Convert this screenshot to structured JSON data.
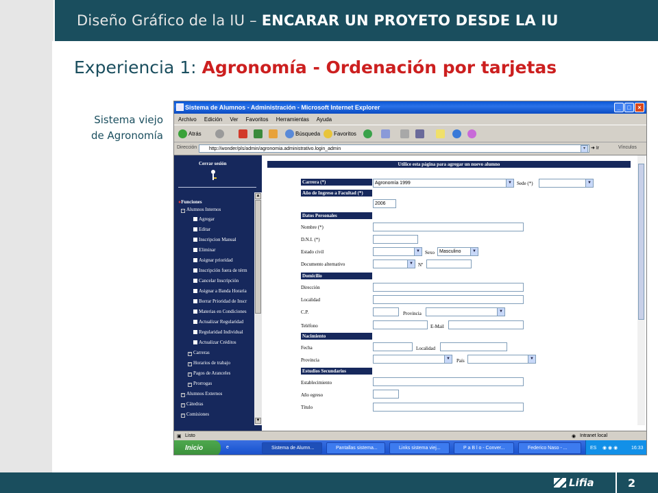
{
  "slide": {
    "title_prefix": "Diseño Gráfico de la IU –",
    "title_bold": "ENCARAR UN PROYETO DESDE LA IU",
    "heading_prefix": "Experiencia 1:",
    "heading_highlight": "Agronomía - Ordenación por tarjetas",
    "caption_line1": "Sistema viejo",
    "caption_line2": "de Agronomía",
    "logo_text": "Lifia",
    "page_number": "2",
    "colors": {
      "brand": "#1a4e5e",
      "highlight": "#cc1f1f",
      "panel": "#e6e6e6"
    }
  },
  "browser": {
    "window_title": "Sistema de Alumnos - Administración - Microsoft Internet Explorer",
    "menu": [
      "Archivo",
      "Edición",
      "Ver",
      "Favoritos",
      "Herramientas",
      "Ayuda"
    ],
    "toolbar": {
      "back": "Atrás",
      "search": "Búsqueda",
      "favorites": "Favoritos"
    },
    "address_label": "Dirección",
    "address_value": "http://wonder/pls/admin/agronomia.administrativo.login_admin",
    "go_label": "Ir",
    "links_label": "Vínculos",
    "status_text": "Listo",
    "zone_text": "Intranet local"
  },
  "sidebar": {
    "logout": "Cerrar sesión",
    "functions": "Funciones",
    "group": "Alumnos Internos",
    "items": [
      "Agregar",
      "Editar",
      "Inscripcion Manual",
      "Eliminar",
      "Asignar prioridad",
      "Inscripción fuera de térm",
      "Cancelar Inscripción",
      "Asignar a Banda Horaria",
      "Borrar Prioridad de Inscr",
      "Materias en Condiciones",
      "Actualizar Regularidad",
      "Regularidad Individual",
      "Actualizar Créditos"
    ],
    "subgroups": [
      "Carreras",
      "Horarios de trabajo",
      "Pagos de Aranceles",
      "Prorrogas"
    ],
    "groups": [
      "Alumnos Externos",
      "Cátedras",
      "Comisiones"
    ]
  },
  "form": {
    "header": "Utilice esta página para agregar un nuevo alumno",
    "carrera_label": "Carrera (*)",
    "carrera_value": "Agronomía 1999",
    "sede_label": "Sede (*)",
    "anio_label": "Año de Ingreso a Facultad (*)",
    "anio_value": "2006",
    "sec_personales": "Datos Personales",
    "nombre_label": "Nombre (*)",
    "dni_label": "D.N.I. (*)",
    "estado_label": "Estado civil",
    "sexo_label": "Sexo",
    "sexo_value": "Masculino",
    "doc_alt_label": "Documento alternativo",
    "nro_label": "Nº",
    "sec_domicilio": "Domicilio",
    "direccion_label": "Dirección",
    "localidad_label": "Localidad",
    "cp_label": "C.P.",
    "provincia_label": "Provincia",
    "telefono_label": "Teléfono",
    "email_label": "E-Mail",
    "sec_nacimiento": "Nacimiento",
    "fecha_label": "Fecha",
    "nac_localidad_label": "Localidad",
    "nac_provincia_label": "Provincia",
    "pais_label": "País",
    "sec_estudios": "Estudios Secundarios",
    "establecimiento_label": "Establecimiento",
    "anio_egreso_label": "Año egreso",
    "titulo_label": "Título"
  },
  "taskbar": {
    "start": "Inicio",
    "tasks": [
      "Sistema de Alumn...",
      "Pantallas sistema...",
      "Links sistema viej...",
      "P a B l o - Conver...",
      "Federico Naso - ..."
    ],
    "lang": "ES",
    "clock": "16:33"
  }
}
